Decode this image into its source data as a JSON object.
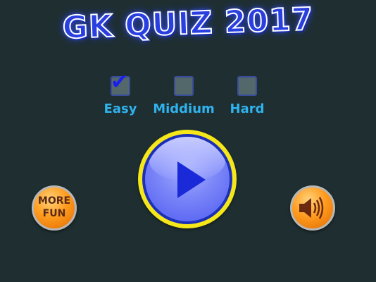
{
  "title": "GK QUIZ 2017",
  "difficulty": {
    "options": [
      {
        "label": "Easy",
        "checked": true
      },
      {
        "label": "Middium",
        "checked": false
      },
      {
        "label": "Hard",
        "checked": false
      }
    ]
  },
  "buttons": {
    "more_line1": "MORE",
    "more_line2": "FUN"
  },
  "icons": {
    "play": "play-icon",
    "sound": "speaker-icon",
    "check": "checkmark-icon"
  },
  "colors": {
    "background": "#1f2f31",
    "title": "#2a3fe0",
    "difficulty_label": "#2fb3ee",
    "play_ring": "#f6e71a",
    "orange_button": "#ff9c1f"
  }
}
